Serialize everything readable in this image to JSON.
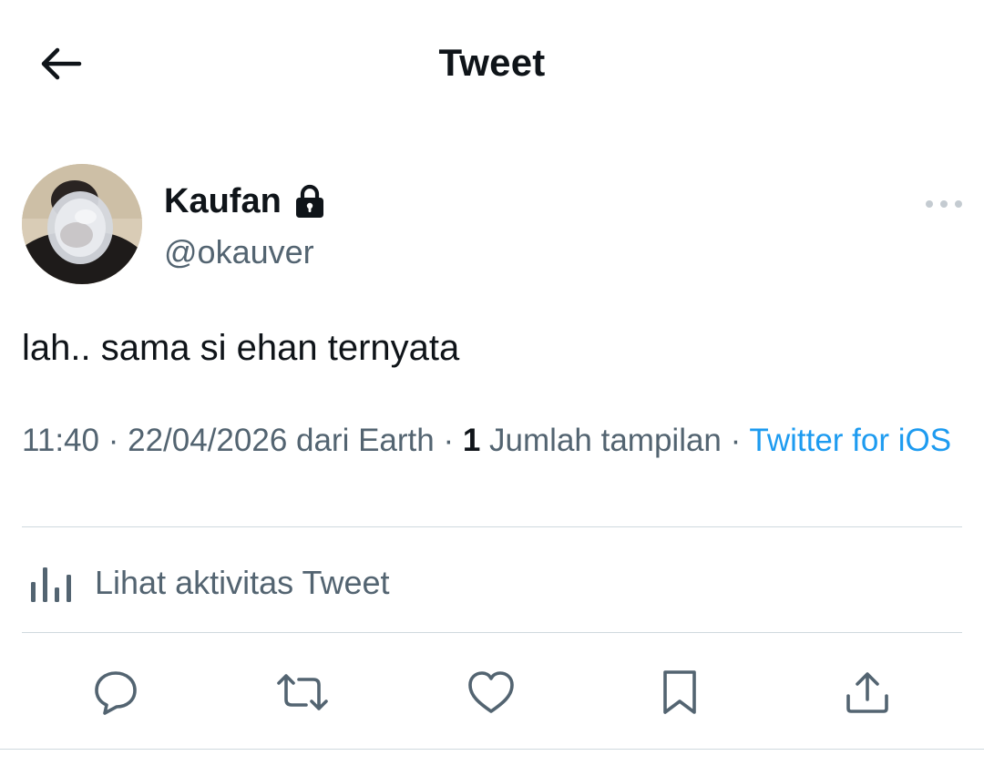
{
  "header": {
    "title": "Tweet",
    "back_icon": "arrow-left-icon"
  },
  "tweet": {
    "author": {
      "display_name": "Kaufan",
      "handle": "@okauver",
      "protected_icon": "lock-icon"
    },
    "text": "lah.. sama si ehan ternyata",
    "meta": {
      "time": "11:40",
      "sep1": " · ",
      "date": "22/04/2026",
      "location": " dari Earth",
      "sep2": " · ",
      "views_count": "1",
      "views_label": " Jumlah tampilan",
      "sep3": " · ",
      "source": "Twitter for iOS"
    },
    "activity_label": "Lihat aktivitas Tweet"
  },
  "actions": [
    {
      "name": "reply",
      "icon": "reply-bubble-icon"
    },
    {
      "name": "retweet",
      "icon": "retweet-icon"
    },
    {
      "name": "like",
      "icon": "heart-icon"
    },
    {
      "name": "bookmark",
      "icon": "bookmark-icon"
    },
    {
      "name": "share",
      "icon": "share-icon"
    }
  ],
  "colors": {
    "text_primary": "#0f1419",
    "text_secondary": "#536471",
    "link": "#1d9bf0",
    "divider": "#cfd9de"
  }
}
